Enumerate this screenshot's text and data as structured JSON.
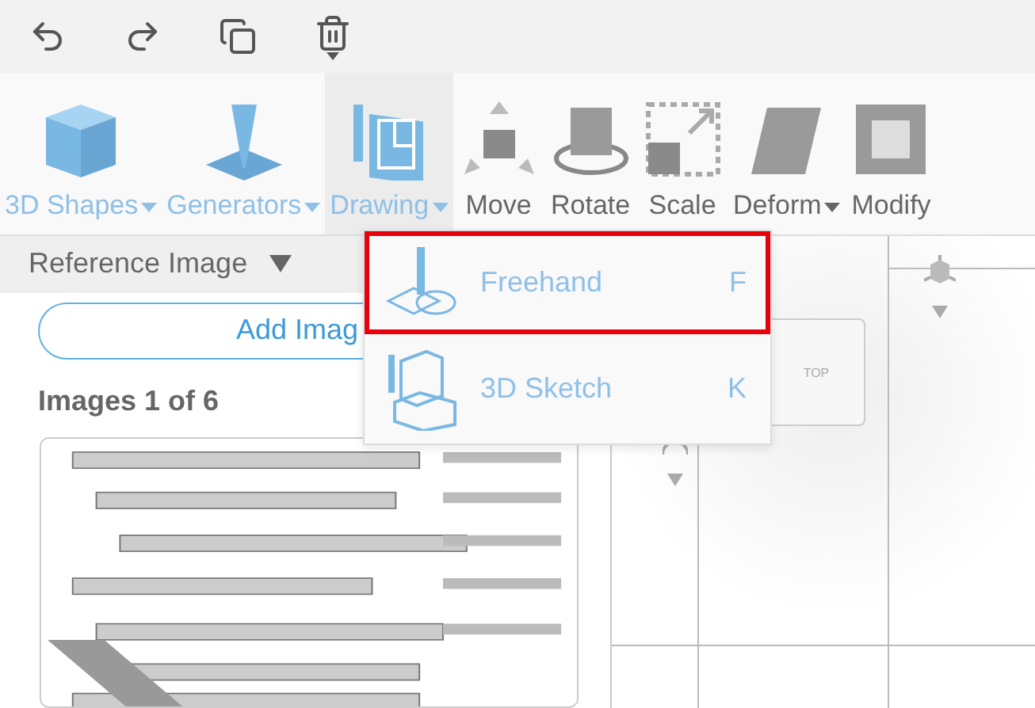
{
  "ribbon": [
    {
      "label": "3D Shapes",
      "kind": "create",
      "dropdown": true,
      "selected": false
    },
    {
      "label": "Generators",
      "kind": "create",
      "dropdown": true,
      "selected": false
    },
    {
      "label": "Drawing",
      "kind": "create",
      "dropdown": true,
      "selected": true
    },
    {
      "label": "Move",
      "kind": "tool",
      "dropdown": false,
      "selected": false
    },
    {
      "label": "Rotate",
      "kind": "tool",
      "dropdown": false,
      "selected": false
    },
    {
      "label": "Scale",
      "kind": "tool",
      "dropdown": false,
      "selected": false
    },
    {
      "label": "Deform",
      "kind": "tool",
      "dropdown": true,
      "selected": false
    },
    {
      "label": "Modify",
      "kind": "tool",
      "dropdown": false,
      "selected": false
    }
  ],
  "panel": {
    "title": "Reference Image",
    "add_button": "Add Imag",
    "images_count": "Images 1 of 6"
  },
  "viewport": {
    "view_cube": "TOP"
  },
  "drawing_menu": [
    {
      "label": "Freehand",
      "shortcut": "F",
      "selected": true
    },
    {
      "label": "3D Sketch",
      "shortcut": "K",
      "selected": false
    }
  ]
}
